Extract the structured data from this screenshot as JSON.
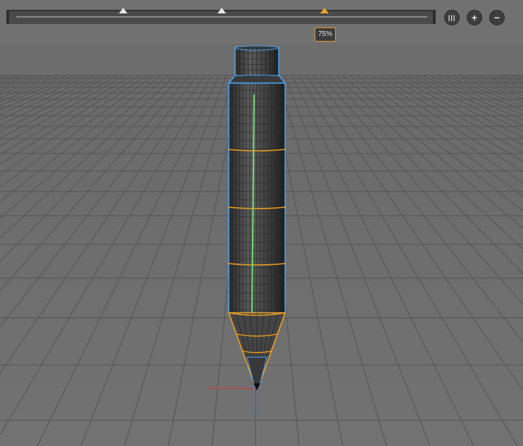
{
  "timeline": {
    "handles": [
      {
        "name": "start-marker",
        "position": 0.26,
        "active": false
      },
      {
        "name": "mid-marker",
        "position": 0.5,
        "active": false
      },
      {
        "name": "current-marker",
        "position": 0.75,
        "active": true
      }
    ],
    "current_label": "75%"
  },
  "controls": {
    "pause_icon": "pause-icon",
    "zoom_in_icon": "plus-icon",
    "zoom_out_icon": "minus-icon"
  },
  "colors": {
    "selection_blue": "#4aa8ff",
    "edge_loop_orange": "#f0a020",
    "axis_green": "#70e070",
    "accent_orange": "#e09a30",
    "axis_red": "#e03030",
    "axis_blue": "#3050e0"
  }
}
